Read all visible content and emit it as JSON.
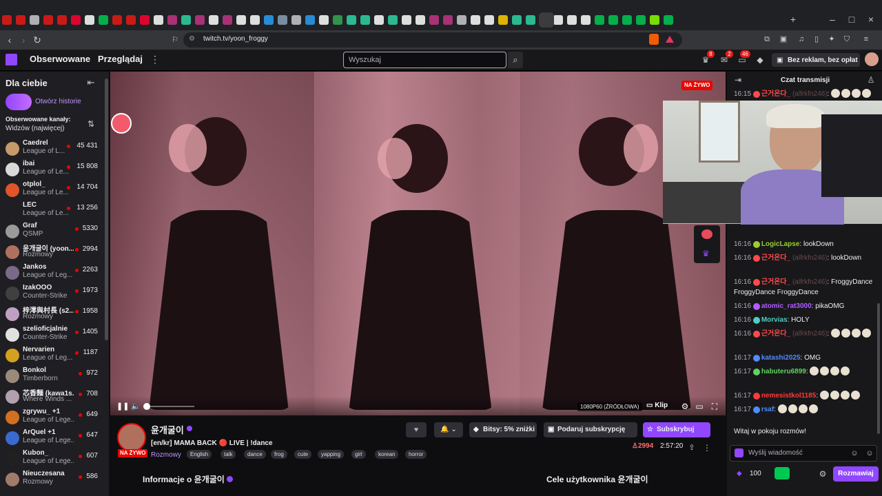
{
  "browser": {
    "url": "twitch.tv/yoon_froggy",
    "tab_colors": [
      "#e91916",
      "#e91916",
      "#c9c9cc",
      "#e91916",
      "#e91916",
      "#ff0033",
      "#ffffff",
      "#00c853",
      "#e91916",
      "#e91916",
      "#ff0033",
      "#ffffff",
      "#c13584",
      "#2fd4a6",
      "#c13584",
      "#ffffff",
      "#c13584",
      "#ffffff",
      "#ffffff",
      "#2a9df4",
      "#8aa0b8",
      "#c9c9cc",
      "#2a9df4",
      "#ffffff",
      "#34a853",
      "#2fd4a6",
      "#2fd4a6",
      "#ffffff",
      "#2fd4a6",
      "#ffffff",
      "#ffffff",
      "#c13584",
      "#c13584",
      "#c9c9cc",
      "#ffffff",
      "#ffffff",
      "#ffcc00",
      "#2fd4a6",
      "#2fd4a6",
      "#2fd4a6",
      "#ffffff",
      "#ffffff",
      "#ffffff",
      "#00c853",
      "#00c853",
      "#00c853",
      "#00c853",
      "#8aff00",
      "#00c853"
    ]
  },
  "nav": {
    "following": "Obserwowane",
    "browse": "Przeglądaj",
    "search_placeholder": "Wyszukaj",
    "badge_notifications": "8",
    "badge_inbox": "2",
    "badge_whispers": "46",
    "ad_free": "Bez reklam, bez opłat"
  },
  "sidebar": {
    "title": "Dla ciebie",
    "stories": "Otwórz historie",
    "followed_header": "Obserwowane kanały:",
    "followed_sort": "Widzów (najwięcej)",
    "channels": [
      {
        "name": "Caedrel",
        "game": "League of L...",
        "viewers": "45 431",
        "color": "#c79a6a"
      },
      {
        "name": "ibai",
        "game": "League of Le...",
        "viewers": "15 808",
        "color": "#d9d9d9"
      },
      {
        "name": "otplol_",
        "game": "League of Le...",
        "viewers": "14 704",
        "color": "#e0552a"
      },
      {
        "name": "LEC",
        "game": "League of Le...",
        "viewers": "13 256",
        "color": "#1f1f23"
      },
      {
        "name": "Graf",
        "game": "QSMP",
        "viewers": "5330",
        "color": "#9a9a9a"
      },
      {
        "name": "윤개굴이 (yoon...",
        "game": "Rozmowy",
        "viewers": "2994",
        "color": "#b07060"
      },
      {
        "name": "Jankos",
        "game": "League of Leg...",
        "viewers": "2263",
        "color": "#7a6a8a"
      },
      {
        "name": "IzakOOO",
        "game": "Counter-Strike",
        "viewers": "1973",
        "color": "#404040"
      },
      {
        "name": "梓澪與村長 (s2...",
        "game": "Rozmowy",
        "viewers": "1958",
        "color": "#c0a0c0"
      },
      {
        "name": "szelioficjalnie",
        "game": "Counter-Strike",
        "viewers": "1405",
        "color": "#e0e0e0"
      },
      {
        "name": "Nervarien",
        "game": "League of Leg...",
        "viewers": "1187",
        "color": "#d4a020"
      },
      {
        "name": "Bonkol",
        "game": "Timberborn",
        "viewers": "972",
        "color": "#9a8a7a"
      },
      {
        "name": "芯香麵 (kawa1s...",
        "game": "Where Winds ...",
        "viewers": "708",
        "color": "#b0a0b0"
      },
      {
        "name": "zgrywu_ +1",
        "game": "League of Lege...",
        "viewers": "649",
        "color": "#d07020"
      },
      {
        "name": "ArQuel +1",
        "game": "League of Lege...",
        "viewers": "647",
        "color": "#3a6ad0"
      },
      {
        "name": "Kubon_",
        "game": "League of Lege...",
        "viewers": "607",
        "color": "#202020"
      },
      {
        "name": "Nieuczesana",
        "game": "Rozmowy",
        "viewers": "586",
        "color": "#a07a6a"
      }
    ]
  },
  "video": {
    "live_badge": "NA ŻYWO",
    "quality": "1080P60 (ŹRÓDŁOWA)",
    "clip": "Klip"
  },
  "stream": {
    "channel": "윤개굴이",
    "title": "[en/kr] MAMA BACK 🔴 LIVE | !dance",
    "category": "Rozmowy",
    "live_badge": "NA ŻYWO",
    "tags": [
      "English",
      "talk",
      "dance",
      "frog",
      "cute",
      "yapping",
      "girl",
      "korean",
      "horror"
    ],
    "bits": "Bitsy: 5% zniżki",
    "gift_sub": "Podaruj subskrypcję",
    "subscribe": "Subskrybuj",
    "viewers": "2994",
    "uptime": "2:57:20",
    "about": "Informacje o 윤개굴이",
    "goals": "Cele użytkownika 윤개굴이"
  },
  "chat": {
    "title": "Czat transmisji",
    "messages": [
      {
        "time": "16:15",
        "user": "근거온다_",
        "handle": "(alfrkfn246)",
        "text": "",
        "color": "#ff4a4a"
      },
      {
        "time": "16:16",
        "user": "LogicLapse",
        "handle": "",
        "text": "lookDown",
        "color": "#9acd32"
      },
      {
        "time": "16:16",
        "user": "근거온다_",
        "handle": "(alfrkfn246)",
        "text": "lookDown",
        "color": "#ff4a4a"
      },
      {
        "time": "16:16",
        "user": "근거온다_",
        "handle": "(alfrkfn246)",
        "text": "FroggyDance FroggyDance FroggyDance",
        "color": "#ff4a4a"
      },
      {
        "time": "16:16",
        "user": "atomic_rat3000",
        "handle": "",
        "text": "pikaOMG",
        "color": "#b05cff"
      },
      {
        "time": "16:16",
        "user": "Morvias",
        "handle": "",
        "text": "HOLY",
        "color": "#4ecdc4"
      },
      {
        "time": "16:16",
        "user": "근거온다_",
        "handle": "(alfrkfn246)",
        "text": "",
        "color": "#ff4a4a"
      },
      {
        "time": "16:17",
        "user": "katashi2025",
        "handle": "",
        "text": "OMG",
        "color": "#4f8cff"
      },
      {
        "time": "16:17",
        "user": "habuteru6899",
        "handle": "",
        "text": "",
        "color": "#5fd35f"
      },
      {
        "time": "16:17",
        "user": "nemesistkol1185",
        "handle": "",
        "text": "",
        "color": "#ff3b3b"
      },
      {
        "time": "16:17",
        "user": "rsaf",
        "handle": "",
        "text": "",
        "color": "#4f8cff"
      }
    ],
    "welcome": "Witaj w pokoju rozmów!",
    "input_placeholder": "Wyślij wiadomość",
    "points": "100",
    "send": "Rozmawiaj"
  }
}
